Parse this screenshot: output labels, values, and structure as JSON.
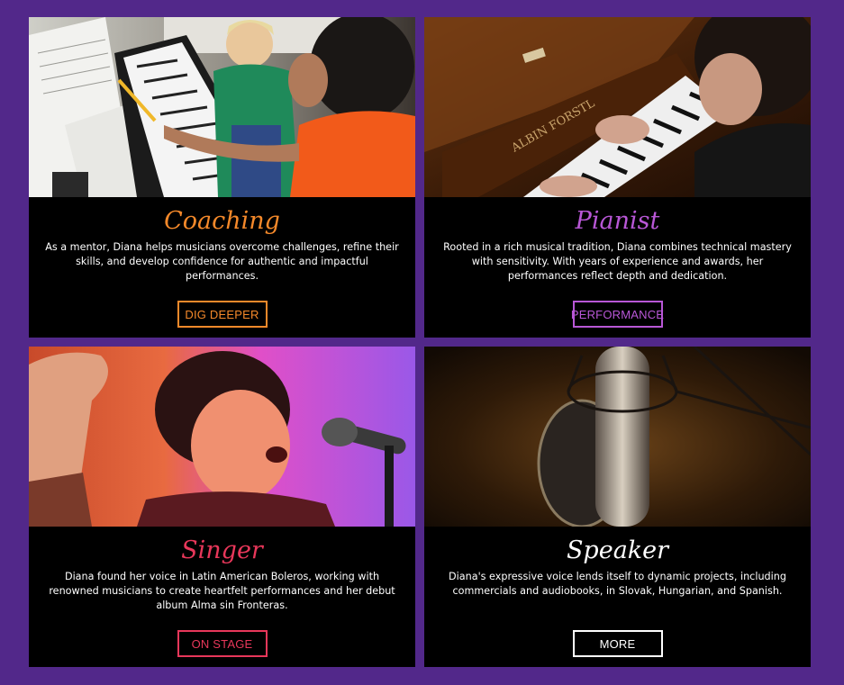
{
  "colors": {
    "background": "#52288a",
    "card": "#000000",
    "coaching": "#f5892a",
    "pianist": "#b857d6",
    "singer": "#e8375a",
    "speaker": "#ffffff"
  },
  "cards": [
    {
      "title": "Coaching",
      "text": "As a mentor, Diana helps musicians overcome challenges, refine their skills, and develop confidence for authentic and impactful performances.",
      "button": "DIG DEEPER",
      "image": "coaching-photo"
    },
    {
      "title": "Pianist",
      "text": "Rooted in a rich musical tradition, Diana combines technical mastery with sensitivity. With years of experience and awards, her performances reflect depth and dedication.",
      "button": "PERFORMANCE",
      "image": "pianist-photo",
      "piano_brand": "ALBIN FORSTL"
    },
    {
      "title": "Singer",
      "text": "Diana found her voice in Latin American Boleros, working with renowned musicians to create heartfelt performances and her debut album Alma sin Fronteras.",
      "button": "ON STAGE",
      "image": "singer-photo"
    },
    {
      "title": "Speaker",
      "text": "Diana's expressive voice lends itself to dynamic projects, including commercials and audiobooks, in Slovak, Hungarian, and Spanish.",
      "button": "MORE",
      "image": "speaker-photo"
    }
  ]
}
